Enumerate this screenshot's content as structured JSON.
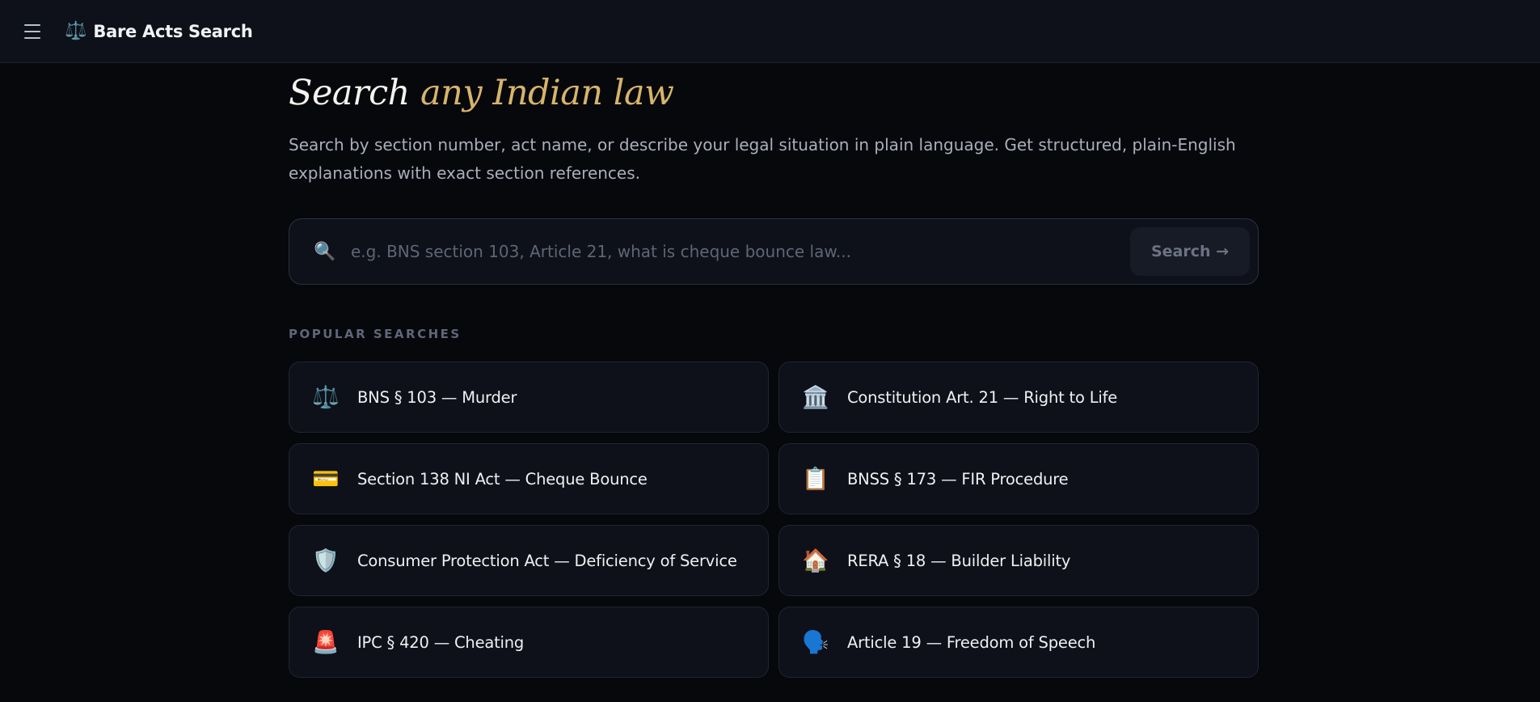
{
  "header": {
    "menu_icon": "hamburger-menu-icon",
    "brand_icon": "⚖️",
    "brand_name": "Bare Acts Search"
  },
  "hero": {
    "title_lead": "Search",
    "title_accent": "any Indian law",
    "description": "Search by section number, act name, or describe your legal situation in plain language. Get structured, plain-English explanations with exact section references."
  },
  "search": {
    "icon": "🔍",
    "placeholder": "e.g. BNS section 103, Article 21, what is cheque bounce law...",
    "value": "",
    "button_label": "Search →"
  },
  "popular": {
    "heading": "POPULAR SEARCHES",
    "items": [
      {
        "icon": "⚖️",
        "icon_name": "scales-icon",
        "label": "BNS § 103 — Murder"
      },
      {
        "icon": "🏛️",
        "icon_name": "classical-building-icon",
        "label": "Constitution Art. 21 — Right to Life"
      },
      {
        "icon": "💳",
        "icon_name": "credit-card-icon",
        "label": "Section 138 NI Act — Cheque Bounce"
      },
      {
        "icon": "📋",
        "icon_name": "clipboard-icon",
        "label": "BNSS § 173 — FIR Procedure"
      },
      {
        "icon": "🛡️",
        "icon_name": "shield-icon",
        "label": "Consumer Protection Act — Deficiency of Service"
      },
      {
        "icon": "🏠",
        "icon_name": "house-icon",
        "label": "RERA § 18 — Builder Liability"
      },
      {
        "icon": "🚨",
        "icon_name": "siren-icon",
        "label": "IPC § 420 — Cheating"
      },
      {
        "icon": "🗣️",
        "icon_name": "speaking-head-icon",
        "label": "Article 19 — Freedom of Speech"
      }
    ]
  },
  "colors": {
    "background": "#07080c",
    "surface": "#0e1119",
    "accent_gold": "#d7b46a",
    "muted_text": "#a9afbb"
  }
}
